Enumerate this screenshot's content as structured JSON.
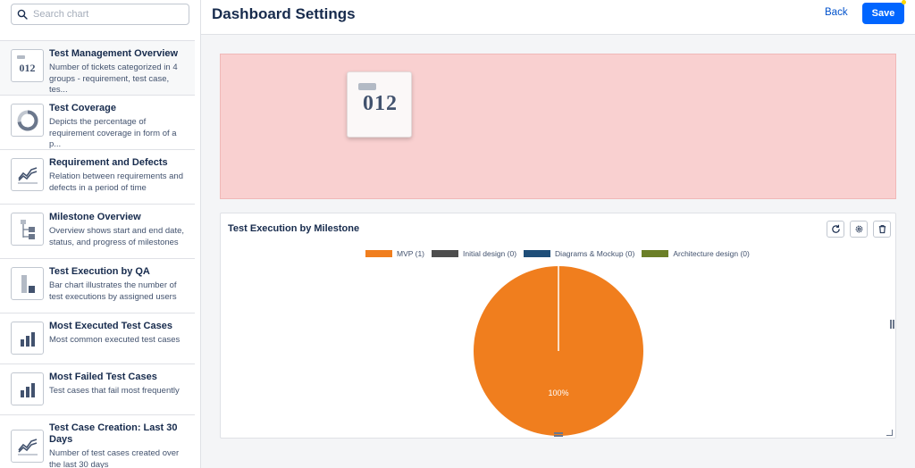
{
  "search": {
    "placeholder": "Search chart"
  },
  "header": {
    "title": "Dashboard Settings",
    "back_label": "Back",
    "save_label": "Save"
  },
  "chart_list": [
    {
      "title": "Test Management Overview",
      "desc": "Number of tickets categorized in 4 groups - requirement, test case, tes...",
      "icon": "counter-icon",
      "thumb_text": "012"
    },
    {
      "title": "Test Coverage",
      "desc": "Depicts the percentage of requirement coverage in form of a p...",
      "icon": "donut-chart-icon"
    },
    {
      "title": "Requirement and Defects",
      "desc": "Relation between requirements and defects in a period of time",
      "icon": "line-chart-icon"
    },
    {
      "title": "Milestone Overview",
      "desc": "Overview shows start and end date, status, and progress of milestones",
      "icon": "tree-chart-icon"
    },
    {
      "title": "Test Execution by QA",
      "desc": "Bar chart illustrates the number of test executions by assigned users",
      "icon": "stacked-bar-icon"
    },
    {
      "title": "Most Executed Test Cases",
      "desc": "Most common executed test cases",
      "icon": "bar-chart-icon"
    },
    {
      "title": "Most Failed Test Cases",
      "desc": "Test cases that fail most frequently",
      "icon": "bar-chart-icon"
    },
    {
      "title": "Test Case Creation: Last 30 Days",
      "desc": "Number of test cases created over the last 30 days",
      "icon": "line-chart-icon"
    }
  ],
  "drop_zone": {
    "card_text": "012"
  },
  "widget": {
    "title": "Test Execution by Milestone",
    "buttons": [
      "refresh-icon",
      "gear-icon",
      "trash-icon"
    ]
  },
  "colors": {
    "accent": "#0065ff",
    "drop_zone": "#f9d0d0",
    "pie_mvp": "#f07e1e"
  },
  "chart_data": {
    "type": "pie",
    "legend_position": "top",
    "series": [
      {
        "name": "MVP (1)",
        "value": 1,
        "color": "#f07e1e"
      },
      {
        "name": "Initial design (0)",
        "value": 0,
        "color": "#4d4d4d"
      },
      {
        "name": "Diagrams & Mockup (0)",
        "value": 0,
        "color": "#1f4e79"
      },
      {
        "name": "Architecture design (0)",
        "value": 0,
        "color": "#6b7f27"
      }
    ],
    "data_labels": [
      "100%"
    ]
  }
}
